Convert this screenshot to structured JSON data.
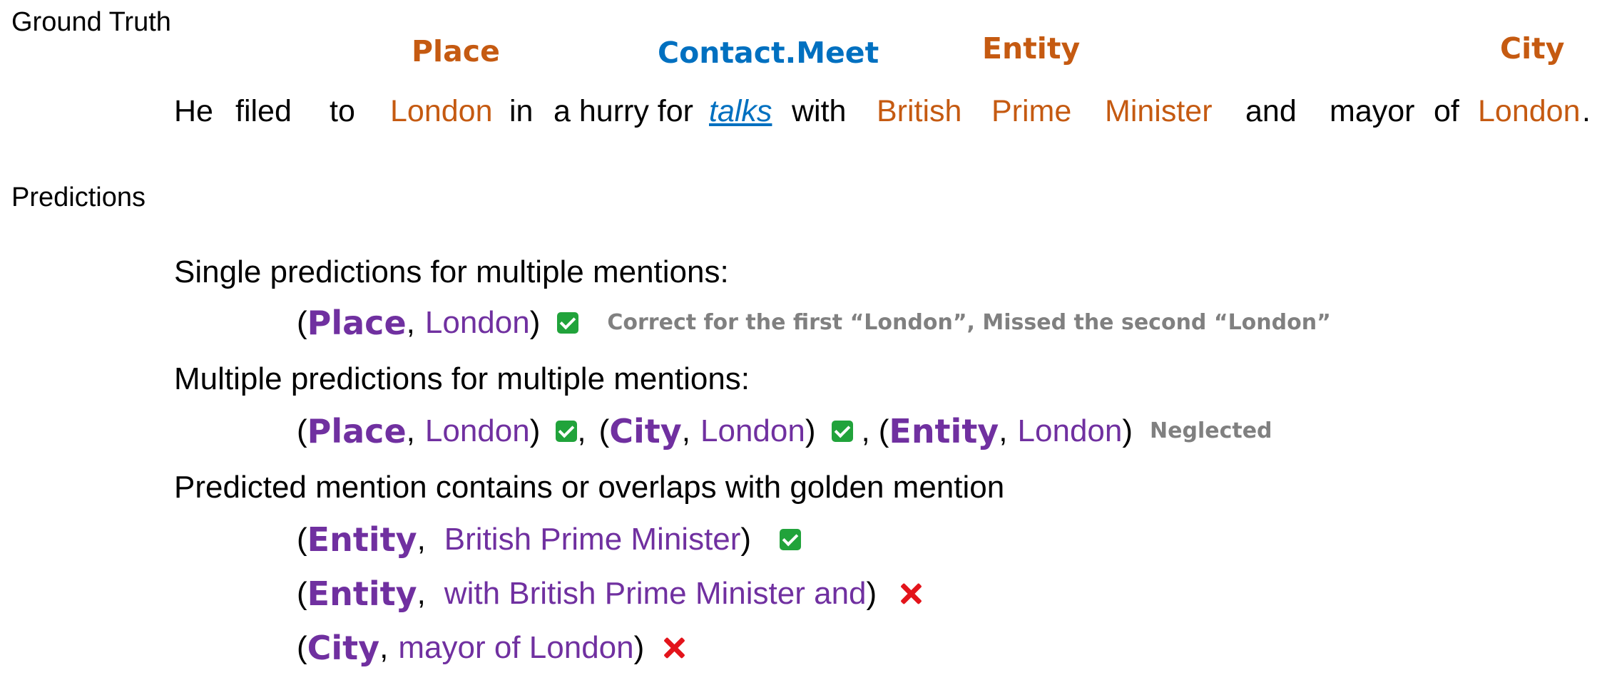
{
  "labels": {
    "ground_truth": "Ground Truth",
    "predictions": "Predictions"
  },
  "ground_truth": {
    "types": {
      "place": "Place",
      "contact_meet": "Contact.Meet",
      "entity": "Entity",
      "city": "City"
    },
    "sentence": {
      "w_he": "He",
      "w_filed": "filed",
      "w_to": "to",
      "w_london1": "London",
      "w_in": "in",
      "w_hurry": "a hurry for",
      "w_talks": "talks",
      "w_with": "with",
      "w_british": "British",
      "w_prime": "Prime",
      "w_minister": "Minister",
      "w_and": "and",
      "w_mayor": "mayor",
      "w_of": "of",
      "w_london2": "London",
      "w_period": "."
    }
  },
  "predictions": {
    "single": {
      "heading": "Single predictions for multiple mentions:",
      "item": {
        "type": "Place",
        "mention": "London",
        "result": "check",
        "note": "Correct for the first “London”, Missed the second “London”"
      }
    },
    "multiple": {
      "heading": "Multiple predictions for multiple mentions:",
      "items": [
        {
          "type": "Place",
          "mention": "London",
          "result": "check"
        },
        {
          "type": "City",
          "mention": "London",
          "result": "check"
        },
        {
          "type": "Entity",
          "mention": "London",
          "result": "none"
        }
      ],
      "note": "Neglected"
    },
    "overlap": {
      "heading": "Predicted mention contains or overlaps with golden mention",
      "items": [
        {
          "type": "Entity",
          "mention": "British Prime Minister",
          "result": "check"
        },
        {
          "type": "Entity",
          "mention": "with British Prime Minister and",
          "result": "cross"
        },
        {
          "type": "City",
          "mention": "mayor of London",
          "result": "cross"
        }
      ]
    }
  },
  "icons": {
    "check": "check-icon",
    "cross": "cross-icon"
  },
  "colors": {
    "gold_mention": "#C55A11",
    "event_trigger": "#0070C0",
    "prediction": "#7030A0",
    "note": "#808080",
    "check": "#21A33B",
    "cross": "#E3141B"
  }
}
